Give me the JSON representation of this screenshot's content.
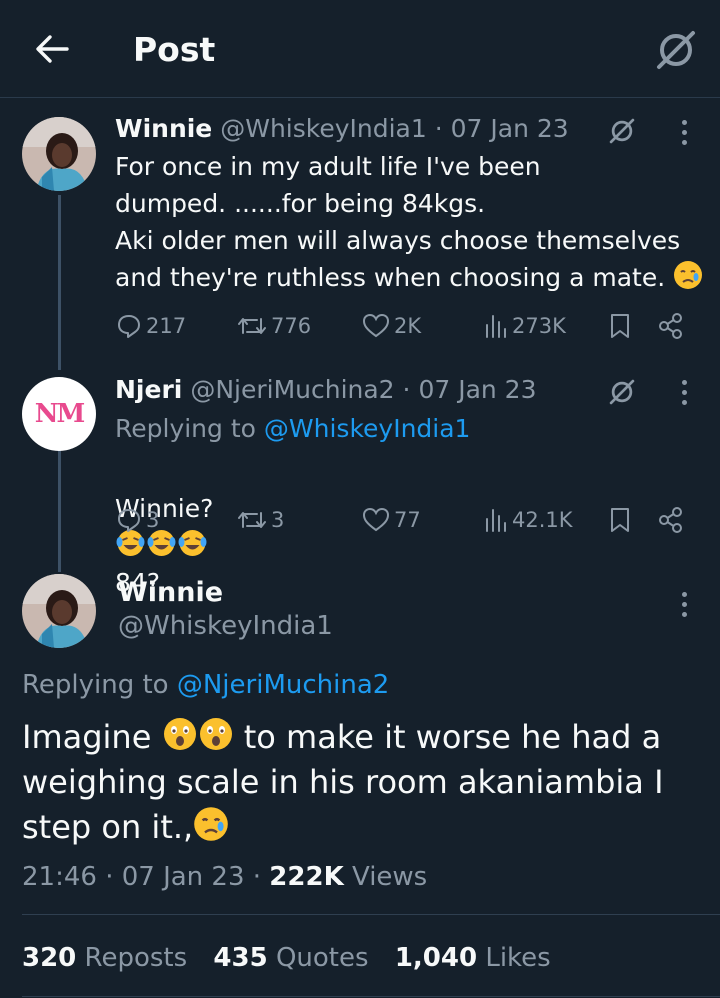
{
  "header": {
    "title": "Post"
  },
  "tweets": [
    {
      "name": "Winnie",
      "handle": "@WhiskeyIndia1",
      "date": "· 07 Jan 23",
      "text": "For once in my adult life I've been\ndumped. ......for being 84kgs.\nAki older men will always choose themselves\nand they're ruthless when choosing a mate.",
      "replies": "217",
      "reposts": "776",
      "likes": "2K",
      "views": "273K"
    },
    {
      "name": "Njeri",
      "handle": "@NjeriMuchina2",
      "date": "· 07 Jan 23",
      "replying_label": "Replying to",
      "replying_handle": "@WhiskeyIndia1",
      "text_prefix": "Winnie?",
      "text_suffix": "84?",
      "replies": "3",
      "reposts": "3",
      "likes": "77",
      "views": "42.1K",
      "avatar_text": "NM"
    }
  ],
  "main": {
    "name": "Winnie",
    "handle": "@WhiskeyIndia1",
    "replying_label": "Replying to",
    "replying_handle": "@NjeriMuchina2",
    "text_a": "Imagine",
    "text_b": "to make it worse he had a weighing scale in his room akaniambia I step on it.,",
    "time": "21:46 · 07 Jan 23 ·",
    "views_count": "222K",
    "views_label": "Views",
    "reposts_count": "320",
    "reposts_label": "Reposts",
    "quotes_count": "435",
    "quotes_label": "Quotes",
    "likes_count": "1,040",
    "likes_label": "Likes"
  },
  "colors": {
    "background": "#15202b",
    "accent": "#1d9bf0",
    "muted": "#8b98a5"
  }
}
